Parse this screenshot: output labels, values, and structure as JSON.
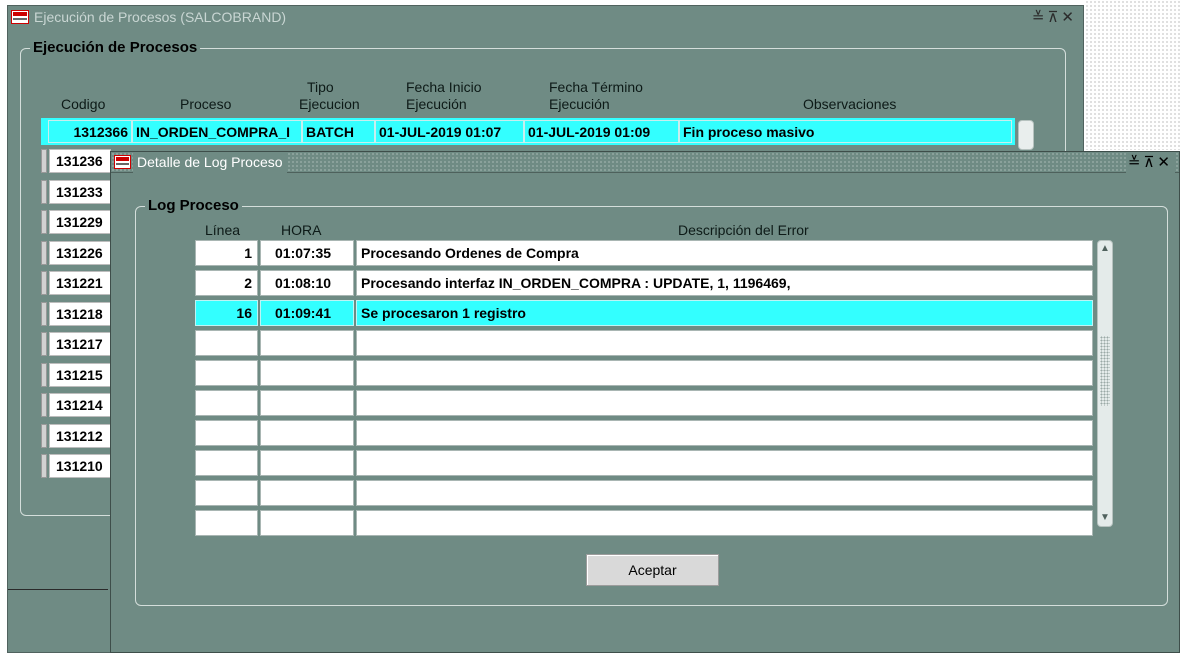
{
  "main_window": {
    "title": "Ejecución de Procesos (SALCOBRAND)",
    "controls": "≚⊼✕",
    "frame_label": "Ejecución de Procesos",
    "headers": {
      "codigo": "Codigo",
      "proceso": "Proceso",
      "tipo_1": "Tipo",
      "tipo_2": "Ejecucion",
      "fecha_inicio_1": "Fecha Inicio",
      "fecha_inicio_2": "Ejecución",
      "fecha_termino_1": "Fecha Término",
      "fecha_termino_2": "Ejecución",
      "observaciones": "Observaciones"
    },
    "selected_row": {
      "codigo": "1312366",
      "proceso": "IN_ORDEN_COMPRA_I",
      "tipo": "BATCH",
      "fecha_inicio": "01-JUL-2019 01:07",
      "fecha_termino": "01-JUL-2019 01:09",
      "observaciones": "Fin proceso masivo"
    },
    "codes": [
      "131236",
      "131233",
      "131229",
      "131226",
      "131221",
      "131218",
      "131217",
      "131215",
      "131214",
      "131212",
      "131210"
    ]
  },
  "dialog": {
    "title": "Detalle de Log Proceso",
    "controls": "≚⊼✕",
    "frame_label": "Log Proceso",
    "headers": {
      "linea": "Línea",
      "hora": "HORA",
      "descripcion": "Descripción del Error"
    },
    "rows": [
      {
        "linea": "1",
        "hora": "01:07:35",
        "descripcion": "Procesando Ordenes de Compra"
      },
      {
        "linea": "2",
        "hora": "01:08:10",
        "descripcion": "Procesando interfaz IN_ORDEN_COMPRA : UPDATE, 1, 1196469,"
      },
      {
        "linea": "16",
        "hora": "01:09:41",
        "descripcion": "Se procesaron 1 registro"
      },
      {
        "linea": "",
        "hora": "",
        "descripcion": ""
      },
      {
        "linea": "",
        "hora": "",
        "descripcion": ""
      },
      {
        "linea": "",
        "hora": "",
        "descripcion": ""
      },
      {
        "linea": "",
        "hora": "",
        "descripcion": ""
      },
      {
        "linea": "",
        "hora": "",
        "descripcion": ""
      },
      {
        "linea": "",
        "hora": "",
        "descripcion": ""
      },
      {
        "linea": "",
        "hora": "",
        "descripcion": ""
      }
    ],
    "selected_index": 2,
    "accept_label": "Aceptar"
  },
  "colors": {
    "window_bg": "#6f8b84",
    "selected_row": "#33ffff"
  }
}
